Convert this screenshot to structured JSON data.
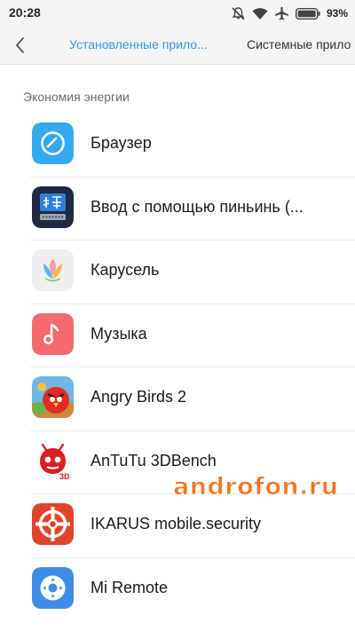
{
  "status_bar": {
    "time": "20:28",
    "battery_percent": "93%",
    "icons": [
      "mute-icon",
      "wifi-icon",
      "airplane-icon",
      "battery-icon"
    ]
  },
  "top_bar": {
    "tabs": [
      {
        "label": "Установленные прило...",
        "active": true
      },
      {
        "label": "Системные прило",
        "active": false
      }
    ],
    "accent_color": "#2c9af0"
  },
  "section": {
    "title": "Экономия энергии"
  },
  "apps": [
    {
      "name": "Браузер",
      "icon": "browser-icon"
    },
    {
      "name": "Ввод с помощью пиньинь (...",
      "icon": "pinyin-keyboard-icon"
    },
    {
      "name": "Карусель",
      "icon": "carousel-icon"
    },
    {
      "name": "Музыка",
      "icon": "music-icon"
    },
    {
      "name": "Angry Birds 2",
      "icon": "angry-birds-icon"
    },
    {
      "name": "AnTuTu 3DBench",
      "icon": "antutu-icon"
    },
    {
      "name": "IKARUS mobile.security",
      "icon": "ikarus-icon"
    },
    {
      "name": "Mi Remote",
      "icon": "mi-remote-icon"
    }
  ],
  "watermark": "androfon.ru"
}
